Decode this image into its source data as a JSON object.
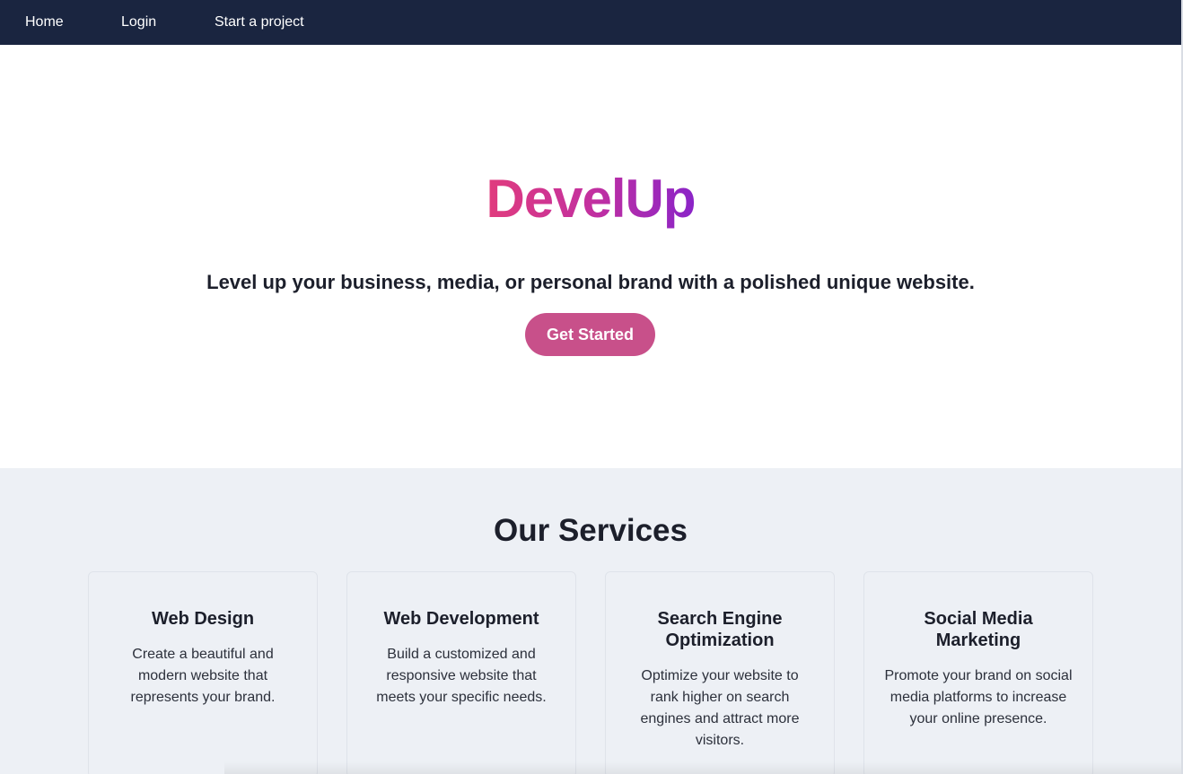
{
  "nav": {
    "items": [
      {
        "label": "Home"
      },
      {
        "label": "Login"
      },
      {
        "label": "Start a project"
      }
    ]
  },
  "hero": {
    "brand": "DevelUp",
    "tagline": "Level up your business, media, or personal brand with a polished unique website.",
    "cta_label": "Get Started"
  },
  "services": {
    "title": "Our Services",
    "cards": [
      {
        "title": "Web Design",
        "text": "Create a beautiful and modern website that represents your brand."
      },
      {
        "title": "Web Development",
        "text": "Build a customized and responsive website that meets your specific needs."
      },
      {
        "title": "Search Engine Optimization",
        "text": "Optimize your website to rank higher on search engines and attract more visitors."
      },
      {
        "title": "Social Media Marketing",
        "text": "Promote your brand on social media platforms to increase your online presence."
      }
    ]
  },
  "colors": {
    "nav_bg": "#1a2540",
    "brand_gradient_start": "#e13c7d",
    "brand_gradient_end": "#8a24c8",
    "cta_bg": "#c8508a",
    "services_bg": "#edf0f5"
  }
}
